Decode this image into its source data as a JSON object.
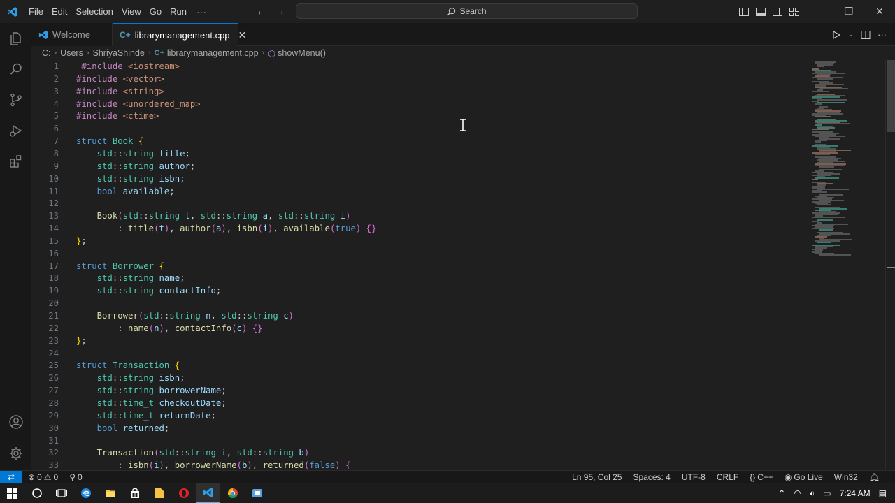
{
  "titlebar": {
    "menu": [
      "File",
      "Edit",
      "Selection",
      "View",
      "Go",
      "Run"
    ],
    "more": "···",
    "search_placeholder": "Search"
  },
  "tabs": [
    {
      "label": "Welcome",
      "active": false
    },
    {
      "label": "librarymanagement.cpp",
      "active": true
    }
  ],
  "breadcrumb": [
    "C:",
    "Users",
    "ShriyaShinde",
    "librarymanagement.cpp",
    "showMenu()"
  ],
  "editor": {
    "lines": [
      {
        "n": "1",
        "code": " #include <iostream>"
      },
      {
        "n": "2",
        "code": "#include <vector>"
      },
      {
        "n": "3",
        "code": "#include <string>"
      },
      {
        "n": "4",
        "code": "#include <unordered_map>"
      },
      {
        "n": "5",
        "code": "#include <ctime>"
      },
      {
        "n": "6",
        "code": ""
      },
      {
        "n": "7",
        "code": "struct Book {"
      },
      {
        "n": "8",
        "code": "    std::string title;"
      },
      {
        "n": "9",
        "code": "    std::string author;"
      },
      {
        "n": "10",
        "code": "    std::string isbn;"
      },
      {
        "n": "11",
        "code": "    bool available;"
      },
      {
        "n": "12",
        "code": ""
      },
      {
        "n": "13",
        "code": "    Book(std::string t, std::string a, std::string i)"
      },
      {
        "n": "14",
        "code": "        : title(t), author(a), isbn(i), available(true) {}"
      },
      {
        "n": "15",
        "code": "};"
      },
      {
        "n": "16",
        "code": ""
      },
      {
        "n": "17",
        "code": "struct Borrower {"
      },
      {
        "n": "18",
        "code": "    std::string name;"
      },
      {
        "n": "19",
        "code": "    std::string contactInfo;"
      },
      {
        "n": "20",
        "code": ""
      },
      {
        "n": "21",
        "code": "    Borrower(std::string n, std::string c)"
      },
      {
        "n": "22",
        "code": "        : name(n), contactInfo(c) {}"
      },
      {
        "n": "23",
        "code": "};"
      },
      {
        "n": "24",
        "code": ""
      },
      {
        "n": "25",
        "code": "struct Transaction {"
      },
      {
        "n": "26",
        "code": "    std::string isbn;"
      },
      {
        "n": "27",
        "code": "    std::string borrowerName;"
      },
      {
        "n": "28",
        "code": "    std::time_t checkoutDate;"
      },
      {
        "n": "29",
        "code": "    std::time_t returnDate;"
      },
      {
        "n": "30",
        "code": "    bool returned;"
      },
      {
        "n": "31",
        "code": ""
      },
      {
        "n": "32",
        "code": "    Transaction(std::string i, std::string b)"
      },
      {
        "n": "33",
        "code": "        : isbn(i), borrowerName(b), returned(false) {"
      }
    ]
  },
  "statusbar": {
    "errors": "0",
    "warnings": "0",
    "ports": "0",
    "position": "Ln 95, Col 25",
    "spaces": "Spaces: 4",
    "encoding": "UTF-8",
    "eol": "CRLF",
    "language": "C++",
    "golive": "Go Live",
    "platform": "Win32"
  },
  "taskbar": {
    "time": "7:24 AM"
  },
  "colors": {
    "accent": "#0078d4",
    "keyword": "#569cd6",
    "type": "#4ec9b0",
    "variable": "#9cdcfe",
    "function": "#dcdcaa",
    "string": "#ce9178",
    "preprocessor": "#c586c0"
  }
}
